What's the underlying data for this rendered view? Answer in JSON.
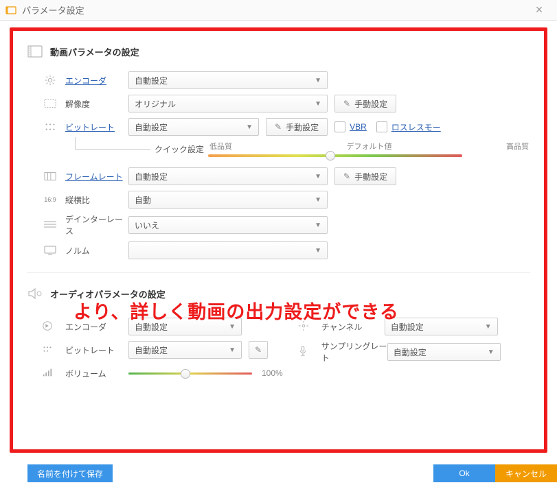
{
  "window": {
    "title": "パラメータ設定",
    "close_label": "×"
  },
  "video_section": {
    "title": "動画パラメータの設定",
    "encoder": {
      "label": "エンコーダ",
      "value": "自動設定"
    },
    "resolution": {
      "label": "解像度",
      "value": "オリジナル",
      "manual_btn": "手動設定"
    },
    "bitrate": {
      "label": "ビットレート",
      "value": "自動設定",
      "manual_btn": "手動設定",
      "vbr_label": "VBR",
      "lossless_label": "ロスレスモー"
    },
    "quick": {
      "label": "クイック設定",
      "low": "低品質",
      "default": "デフォルト値",
      "high": "高品質",
      "position_pct": 48
    },
    "framerate": {
      "label": "フレームレート",
      "value": "自動設定",
      "manual_btn": "手動設定"
    },
    "aspect": {
      "label": "縦横比",
      "value": "自動"
    },
    "deinterlace": {
      "label": "デインターレース",
      "value": "いいえ"
    },
    "norm": {
      "label": "ノルム"
    }
  },
  "overlay": "より、詳しく動画の出力設定ができる",
  "audio_section": {
    "title": "オーディオパラメータの設定",
    "encoder": {
      "label": "エンコーダ",
      "value": "自動設定"
    },
    "channel": {
      "label": "チャンネル",
      "value": "自動設定"
    },
    "bitrate": {
      "label": "ビットレート",
      "value": "自動設定"
    },
    "samplerate": {
      "label": "サンプリングレート",
      "value": "自動設定"
    },
    "volume": {
      "label": "ボリューム",
      "value_text": "100%",
      "position_pct": 46
    }
  },
  "footer": {
    "save_as": "名前を付けて保存",
    "ok": "Ok",
    "cancel": "キャンセル"
  }
}
